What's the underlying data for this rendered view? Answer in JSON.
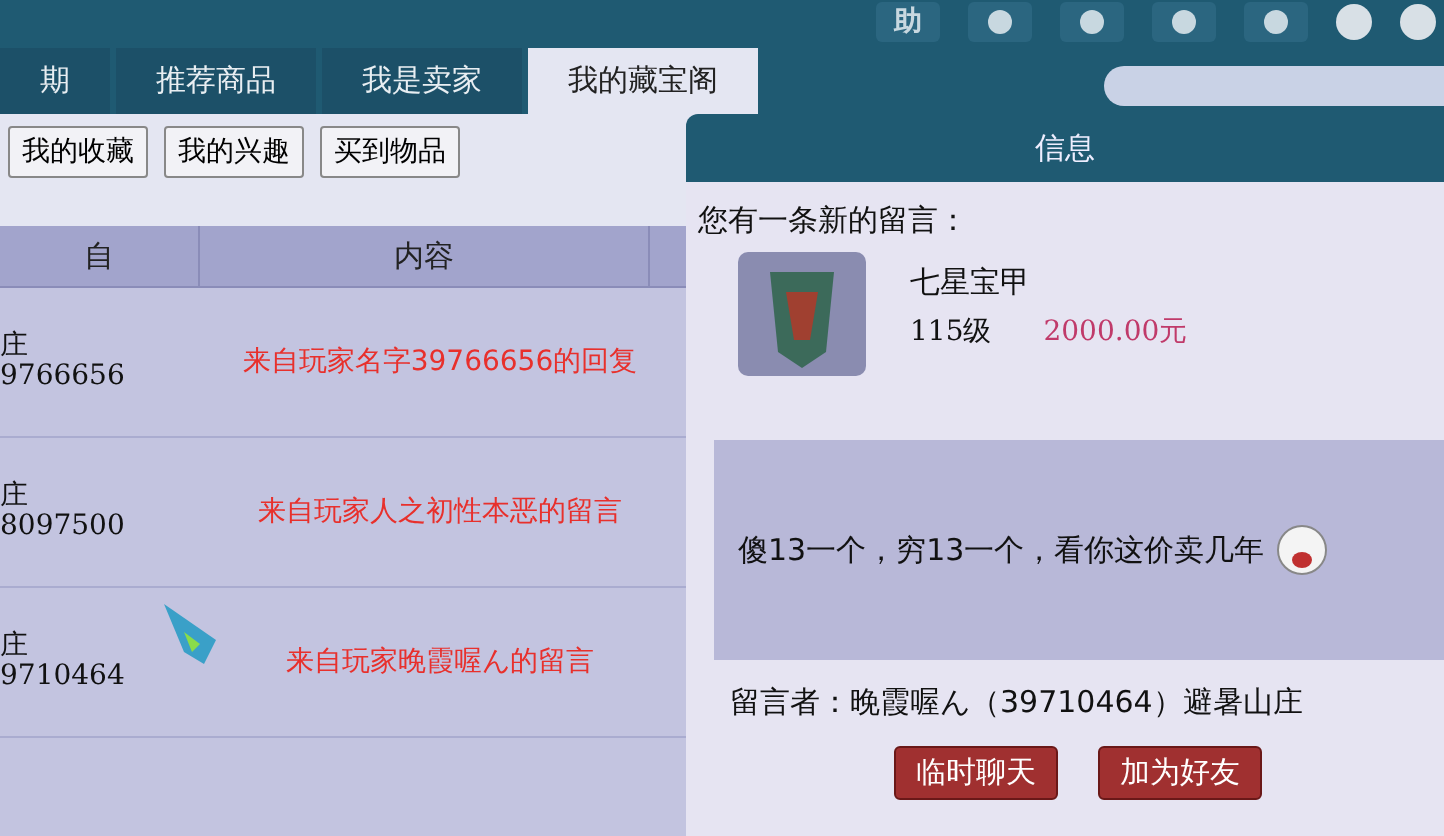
{
  "toolbar": {
    "help_label": "助"
  },
  "tabs": [
    {
      "label": "期",
      "selected": false
    },
    {
      "label": "推荐商品",
      "selected": false
    },
    {
      "label": "我是卖家",
      "selected": false
    },
    {
      "label": "我的藏宝阁",
      "selected": true
    }
  ],
  "subtabs": [
    "我的收藏",
    "我的兴趣",
    "买到物品"
  ],
  "table": {
    "columns": [
      "自",
      "内容"
    ],
    "rows": [
      {
        "from": "庄",
        "id": "9766656",
        "content": "来自玩家名字39766656的回复"
      },
      {
        "from": "庄",
        "id": "8097500",
        "content": "来自玩家人之初性本恶的留言"
      },
      {
        "from": "庄",
        "id": "9710464",
        "content": "来自玩家晚霞喔ん的留言"
      }
    ]
  },
  "dialog": {
    "title": "信息",
    "notice": "您有一条新的留言：",
    "item": {
      "name": "七星宝甲",
      "level": "115级",
      "price": "2000.00元"
    },
    "message": "傻13一个，穷13一个，看你这价卖几年",
    "sender": "留言者：晚霞喔ん（39710464）避暑山庄",
    "buttons": [
      "临时聊天",
      "加为好友"
    ]
  }
}
